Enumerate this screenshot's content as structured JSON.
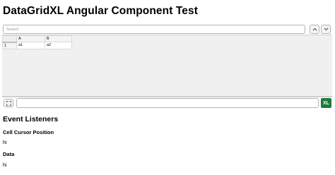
{
  "page": {
    "title": "DataGridXL Angular Component Test"
  },
  "toolbar": {
    "search_placeholder": "Search",
    "prev_icon": "chevron-up-icon",
    "next_icon": "chevron-down-icon"
  },
  "grid": {
    "columns": [
      "A",
      "B"
    ],
    "rows": [
      {
        "header": "1",
        "cells": [
          "a1",
          "a2"
        ]
      }
    ]
  },
  "formula_bar": {
    "expand_icon": "expand-icon",
    "value": "",
    "logo_text": "XL",
    "logo_color": "#1e7a3c"
  },
  "event_listeners": {
    "heading": "Event Listeners",
    "cursor_label": "Cell Cursor Position",
    "cursor_value": "hi",
    "data_label": "Data",
    "data_value": "hi"
  }
}
